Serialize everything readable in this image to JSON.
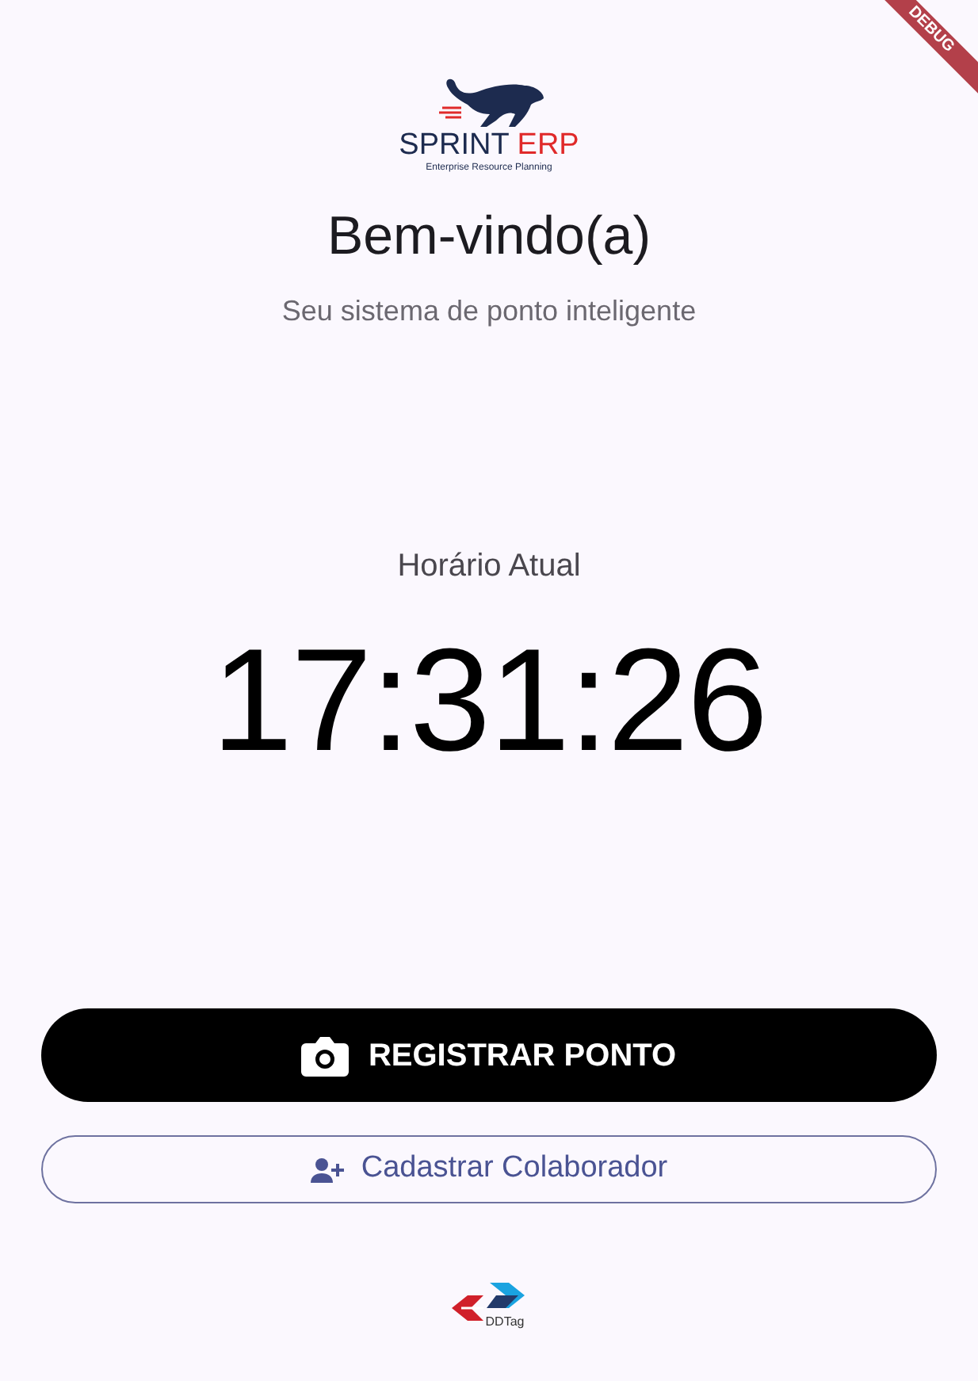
{
  "debug_banner": "DEBUG",
  "logo": {
    "brand": "SPRINT",
    "brand_accent": "ERP",
    "tagline": "Enterprise Resource Planning"
  },
  "title": "Bem-vindo(a)",
  "subtitle": "Seu sistema de ponto inteligente",
  "clock": {
    "label": "Horário Atual",
    "time": "17:31:26"
  },
  "buttons": [
    {
      "kind": "filled",
      "label": "REGISTRAR PONTO"
    },
    {
      "kind": "outline",
      "label": "Cadastrar Colaborador"
    }
  ],
  "footer_logo": {
    "text": "DDTag"
  }
}
